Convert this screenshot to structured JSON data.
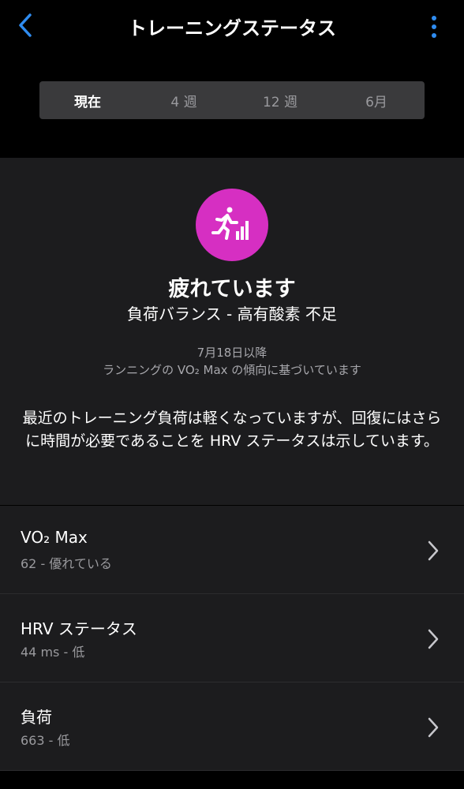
{
  "header": {
    "title": "トレーニングステータス",
    "back_icon": "chevron-left-icon",
    "more_icon": "more-vertical-icon",
    "accent": "#2f8cf0"
  },
  "segments": [
    {
      "label": "現在",
      "active": true
    },
    {
      "label": "4 週",
      "active": false
    },
    {
      "label": "12 週",
      "active": false
    },
    {
      "label": "6月",
      "active": false
    }
  ],
  "status": {
    "icon": "training-status-icon",
    "icon_color": "#d62fc2",
    "title": "疲れています",
    "subtitle": "負荷バランス - 高有酸素 不足",
    "since": "7月18日以降",
    "basis": "ランニングの VO₂ Max の傾向に基づいています",
    "description": "最近のトレーニング負荷は軽くなっていますが、回復にはさらに時間が必要であることを HRV ステータスは示しています。"
  },
  "metrics": [
    {
      "title": "VO₂ Max",
      "subtitle": "62 - 優れている"
    },
    {
      "title": "HRV ステータス",
      "subtitle": "44 ms - 低"
    },
    {
      "title": "負荷",
      "subtitle": "663 - 低"
    }
  ]
}
